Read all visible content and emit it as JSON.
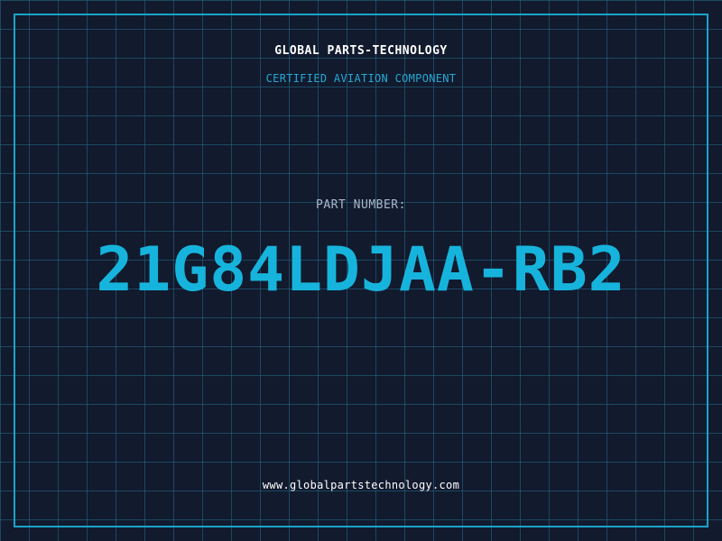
{
  "header": {
    "company": "GLOBAL PARTS-TECHNOLOGY",
    "subtitle": "CERTIFIED AVIATION COMPONENT"
  },
  "part": {
    "label": "PART NUMBER:",
    "number": "21G84LDJAA-RB2"
  },
  "footer": {
    "website": "www.globalpartstechnology.com"
  },
  "colors": {
    "background": "#121a2e",
    "grid": "#246e8a",
    "accent": "#16b4dc",
    "frame": "#1aa3c9",
    "text": "#ffffff"
  }
}
